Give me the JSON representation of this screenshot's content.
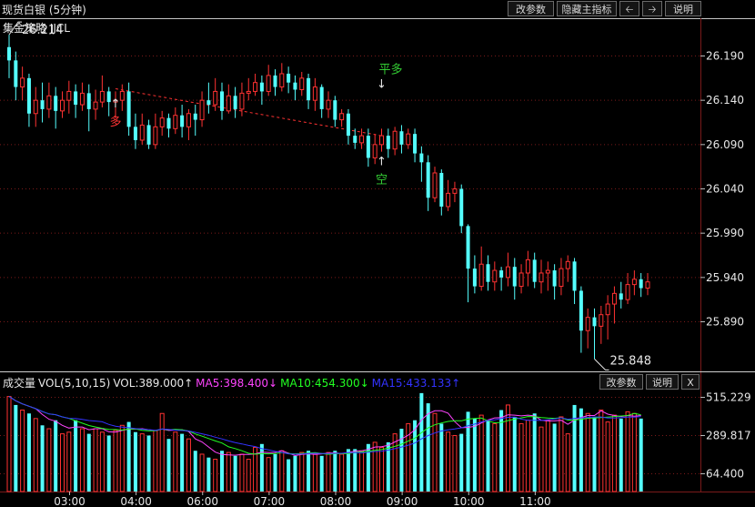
{
  "window": {
    "title": "现货白银 (5分钟)",
    "buttons": {
      "params": "改参数",
      "hide_indicator": "隐藏主指标",
      "left_icon": "arrow-left",
      "right_icon": "arrow-right",
      "help": "说明"
    }
  },
  "strategy": {
    "label": "集金策略 JJCL"
  },
  "price_panel": {
    "y_ticks": [
      "26.190",
      "26.140",
      "26.090",
      "26.040",
      "25.990",
      "25.940",
      "25.890"
    ],
    "high_marker": "26.214",
    "low_marker": "25.848",
    "signals": {
      "buy": "多",
      "close_long": "平多",
      "sell": "空"
    }
  },
  "volume_panel": {
    "indicator": "成交量",
    "params": "VOL(5,10,15)",
    "vol": "VOL:389.000↑",
    "ma5": "MA5:398.400↓",
    "ma10": "MA10:454.300↓",
    "ma15": "MA15:433.133↑",
    "y_ticks": [
      "515.229",
      "289.817",
      "64.400"
    ],
    "buttons": {
      "params": "改参数",
      "help": "说明",
      "close": "X"
    }
  },
  "x_ticks": [
    "03:00",
    "04:00",
    "06:00",
    "07:00",
    "08:00",
    "09:00",
    "10:00",
    "11:00"
  ],
  "colors": {
    "up": "#ff3232",
    "down": "#54ffff",
    "ma5": "#ff44ff",
    "ma10": "#22ff22",
    "ma15": "#3333ff",
    "vol_line": "#e8e8e8",
    "grid": "#7a1a1a",
    "signal_buy": "#ff3333",
    "signal_sell": "#33cc33"
  },
  "chart_data": {
    "type": "candlestick",
    "title": "现货白银 (5分钟)",
    "xlabel": "",
    "ylabel": "",
    "ylim": [
      25.83,
      26.225
    ],
    "x_ticks": [
      "03:00",
      "04:00",
      "06:00",
      "07:00",
      "08:00",
      "09:00",
      "10:00",
      "11:00"
    ],
    "candles": [
      [
        26.2,
        26.185,
        26.214,
        26.165
      ],
      [
        26.185,
        26.155,
        26.195,
        26.14
      ],
      [
        26.155,
        26.165,
        26.178,
        26.14
      ],
      [
        26.165,
        26.125,
        26.17,
        26.11
      ],
      [
        26.125,
        26.14,
        26.155,
        26.11
      ],
      [
        26.14,
        26.13,
        26.16,
        26.115
      ],
      [
        26.13,
        26.145,
        26.16,
        26.12
      ],
      [
        26.145,
        26.128,
        26.155,
        26.108
      ],
      [
        26.128,
        26.14,
        26.15,
        26.12
      ],
      [
        26.14,
        26.15,
        26.162,
        26.125
      ],
      [
        26.15,
        26.135,
        26.158,
        26.12
      ],
      [
        26.135,
        26.148,
        26.16,
        26.128
      ],
      [
        26.148,
        26.13,
        26.158,
        26.105
      ],
      [
        26.13,
        26.138,
        26.152,
        26.118
      ],
      [
        26.138,
        26.15,
        26.168,
        26.132
      ],
      [
        26.15,
        26.138,
        26.155,
        26.122
      ],
      [
        26.138,
        26.14,
        26.15,
        26.12
      ],
      [
        26.14,
        26.15,
        26.158,
        26.128
      ],
      [
        26.15,
        26.11,
        26.16,
        26.1
      ],
      [
        26.11,
        26.095,
        26.125,
        26.085
      ],
      [
        26.095,
        26.112,
        26.125,
        26.09
      ],
      [
        26.112,
        26.09,
        26.118,
        26.085
      ],
      [
        26.09,
        26.11,
        26.125,
        26.085
      ],
      [
        26.11,
        26.12,
        26.128,
        26.1
      ],
      [
        26.12,
        26.108,
        26.125,
        26.098
      ],
      [
        26.108,
        26.123,
        26.132,
        26.102
      ],
      [
        26.123,
        26.11,
        26.135,
        26.098
      ],
      [
        26.11,
        26.125,
        26.13,
        26.095
      ],
      [
        26.125,
        26.118,
        26.135,
        26.1
      ],
      [
        26.118,
        26.14,
        26.15,
        26.11
      ],
      [
        26.14,
        26.135,
        26.16,
        26.125
      ],
      [
        26.135,
        26.15,
        26.165,
        26.128
      ],
      [
        26.15,
        26.128,
        26.16,
        26.118
      ],
      [
        26.128,
        26.145,
        26.158,
        26.125
      ],
      [
        26.145,
        26.13,
        26.155,
        26.12
      ],
      [
        26.13,
        26.148,
        26.16,
        26.122
      ],
      [
        26.148,
        26.15,
        26.165,
        26.14
      ],
      [
        26.15,
        26.16,
        26.17,
        26.145
      ],
      [
        26.16,
        26.15,
        26.168,
        26.135
      ],
      [
        26.15,
        26.168,
        26.18,
        26.145
      ],
      [
        26.168,
        26.155,
        26.175,
        26.145
      ],
      [
        26.155,
        26.17,
        26.182,
        26.15
      ],
      [
        26.17,
        26.16,
        26.178,
        26.148
      ],
      [
        26.16,
        26.152,
        26.168,
        26.14
      ],
      [
        26.152,
        26.165,
        26.172,
        26.145
      ],
      [
        26.165,
        26.14,
        26.17,
        26.13
      ],
      [
        26.14,
        26.155,
        26.165,
        26.128
      ],
      [
        26.155,
        26.13,
        26.158,
        26.12
      ],
      [
        26.13,
        26.14,
        26.15,
        26.12
      ],
      [
        26.14,
        26.118,
        26.145,
        26.11
      ],
      [
        26.118,
        26.125,
        26.13,
        26.11
      ],
      [
        26.125,
        26.1,
        26.13,
        26.09
      ],
      [
        26.1,
        26.092,
        26.108,
        26.085
      ],
      [
        26.092,
        26.1,
        26.108,
        26.085
      ],
      [
        26.1,
        26.075,
        26.108,
        26.065
      ],
      [
        26.075,
        26.09,
        26.102,
        26.068
      ],
      [
        26.09,
        26.1,
        26.108,
        26.082
      ],
      [
        26.1,
        26.085,
        26.108,
        26.075
      ],
      [
        26.085,
        26.105,
        26.11,
        26.078
      ],
      [
        26.105,
        26.09,
        26.112,
        26.08
      ],
      [
        26.09,
        26.102,
        26.108,
        26.085
      ],
      [
        26.102,
        26.08,
        26.108,
        26.07
      ],
      [
        26.08,
        26.07,
        26.088,
        26.048
      ],
      [
        26.07,
        26.03,
        26.078,
        26.015
      ],
      [
        26.03,
        26.058,
        26.065,
        26.025
      ],
      [
        26.058,
        26.02,
        26.062,
        26.01
      ],
      [
        26.02,
        26.035,
        26.05,
        26.015
      ],
      [
        26.035,
        26.04,
        26.048,
        26.025
      ],
      [
        26.04,
        25.998,
        26.045,
        25.99
      ],
      [
        25.998,
        25.95,
        26.0,
        25.912
      ],
      [
        25.95,
        25.93,
        25.965,
        25.922
      ],
      [
        25.93,
        25.955,
        25.975,
        25.925
      ],
      [
        25.955,
        25.935,
        25.965,
        25.925
      ],
      [
        25.935,
        25.948,
        25.958,
        25.925
      ],
      [
        25.948,
        25.94,
        25.952,
        25.925
      ],
      [
        25.94,
        25.952,
        25.968,
        25.93
      ],
      [
        25.952,
        25.93,
        25.962,
        25.915
      ],
      [
        25.93,
        25.945,
        25.955,
        25.922
      ],
      [
        25.945,
        25.96,
        25.97,
        25.93
      ],
      [
        25.96,
        25.935,
        25.968,
        25.928
      ],
      [
        25.935,
        25.945,
        25.96,
        25.922
      ],
      [
        25.945,
        25.948,
        25.958,
        25.925
      ],
      [
        25.948,
        25.93,
        25.955,
        25.915
      ],
      [
        25.93,
        25.95,
        25.962,
        25.92
      ],
      [
        25.95,
        25.958,
        25.965,
        25.935
      ],
      [
        25.958,
        25.925,
        25.962,
        25.91
      ],
      [
        25.925,
        25.88,
        25.93,
        25.855
      ],
      [
        25.88,
        25.895,
        25.905,
        25.86
      ],
      [
        25.895,
        25.885,
        25.905,
        25.848
      ],
      [
        25.885,
        25.898,
        25.908,
        25.865
      ],
      [
        25.898,
        25.91,
        25.92,
        25.87
      ],
      [
        25.91,
        25.922,
        25.93,
        25.888
      ],
      [
        25.922,
        25.915,
        25.935,
        25.905
      ],
      [
        25.915,
        25.932,
        25.945,
        25.91
      ],
      [
        25.932,
        25.938,
        25.948,
        25.92
      ],
      [
        25.938,
        25.928,
        25.945,
        25.918
      ],
      [
        25.928,
        25.935,
        25.945,
        25.92
      ]
    ],
    "volumes": [
      520,
      470,
      440,
      420,
      390,
      350,
      330,
      380,
      300,
      310,
      380,
      330,
      300,
      330,
      310,
      290,
      320,
      350,
      370,
      310,
      300,
      290,
      320,
      420,
      270,
      310,
      300,
      270,
      200,
      180,
      160,
      150,
      200,
      190,
      170,
      180,
      150,
      220,
      240,
      160,
      180,
      200,
      150,
      170,
      190,
      200,
      180,
      170,
      190,
      200,
      180,
      210,
      210,
      200,
      240,
      250,
      220,
      250,
      300,
      330,
      360,
      380,
      540,
      480,
      420,
      360,
      310,
      290,
      300,
      430,
      390,
      410,
      380,
      360,
      440,
      470,
      400,
      360,
      380,
      420,
      340,
      380,
      360,
      400,
      300,
      470,
      450,
      420,
      400,
      440,
      370,
      410,
      390,
      430,
      420,
      390
    ],
    "vol_up": [
      1,
      0,
      1,
      0,
      1,
      0,
      1,
      0,
      1,
      1,
      0,
      1,
      0,
      1,
      1,
      0,
      1,
      1,
      0,
      0,
      1,
      0,
      1,
      1,
      0,
      1,
      0,
      1,
      0,
      1,
      0,
      1,
      0,
      1,
      0,
      1,
      1,
      1,
      0,
      1,
      0,
      1,
      0,
      0,
      1,
      0,
      1,
      0,
      1,
      0,
      1,
      0,
      0,
      1,
      0,
      1,
      1,
      0,
      1,
      0,
      1,
      0,
      0,
      0,
      1,
      0,
      1,
      1,
      0,
      0,
      0,
      1,
      0,
      1,
      0,
      1,
      0,
      1,
      1,
      0,
      1,
      1,
      0,
      1,
      1,
      0,
      0,
      1,
      0,
      1,
      1,
      1,
      0,
      1,
      1,
      0
    ],
    "ma5_last": 398.4,
    "ma10_last": 454.3,
    "ma15_last": 433.133,
    "vol_last": 389.0,
    "signals": [
      {
        "index": 16,
        "type": "多"
      },
      {
        "index": 56,
        "type": "平多"
      },
      {
        "index": 56,
        "type": "空"
      }
    ]
  }
}
